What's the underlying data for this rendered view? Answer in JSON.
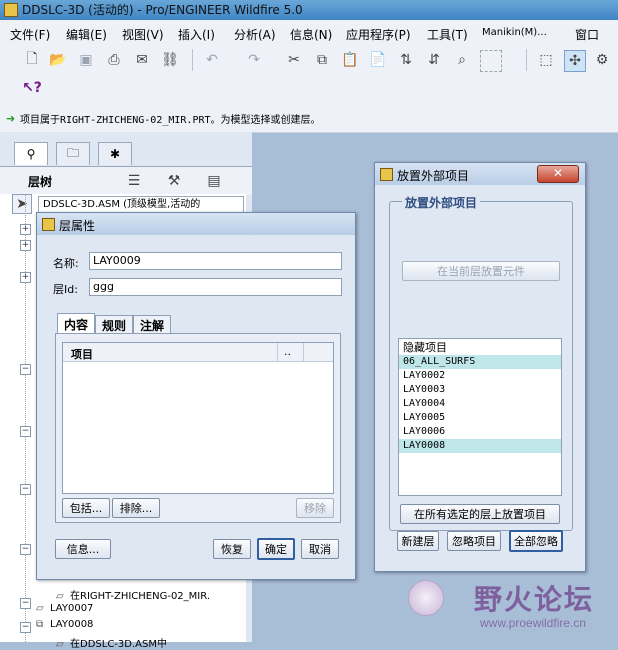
{
  "window": {
    "title": "DDSLC-3D (活动的) - Pro/ENGINEER Wildfire 5.0"
  },
  "menu": [
    "文件(F)",
    "编辑(E)",
    "视图(V)",
    "插入(I)",
    "分析(A)",
    "信息(N)",
    "应用程序(P)",
    "工具(T)",
    "Manikin(M)...",
    "窗口(W)"
  ],
  "status_message": "项目属于RIGHT-ZHICHENG-02_MIR.PRT。为模型选择或创建层。",
  "left_panel": {
    "header_label": "层树",
    "model_select": "DDSLC-3D.ASM (顶级模型,活动的",
    "tree_items": [
      "在RIGHT-ZHICHENG-02_MIR.",
      "LAY0007",
      "LAY0008",
      "在DDSLC-3D.ASM中"
    ]
  },
  "layer_props": {
    "title": "层属性",
    "name_label": "名称:",
    "name_value": "LAY0009",
    "id_label": "层Id:",
    "id_value": "ggg",
    "tabs": [
      "内容",
      "规则",
      "注解"
    ],
    "columns": [
      "项目",
      ".."
    ],
    "buttons": {
      "include": "包括...",
      "exclude": "排除...",
      "remove": "移除",
      "info": "信息...",
      "restore": "恢复",
      "ok": "确定",
      "cancel": "取消"
    }
  },
  "place_items": {
    "title": "放置外部项目",
    "group_label": "放置外部项目",
    "place_on_current": "在当前层放置元件",
    "list": [
      {
        "label": "隐藏项目",
        "selected": false
      },
      {
        "label": "06_ALL_SURFS",
        "selected": true
      },
      {
        "label": "LAY0002",
        "selected": false
      },
      {
        "label": "LAY0003",
        "selected": false
      },
      {
        "label": "LAY0004",
        "selected": false
      },
      {
        "label": "LAY0005",
        "selected": false
      },
      {
        "label": "LAY0006",
        "selected": false
      },
      {
        "label": "LAY0008",
        "selected": true
      }
    ],
    "place_all": "在所有选定的层上放置项目",
    "buttons": {
      "new_layer": "新建层",
      "ignore": "忽略项目",
      "ignore_all": "全部忽略"
    }
  },
  "watermark": {
    "text_cn": "野火论坛",
    "url": "www.proewildfire.cn"
  },
  "colors": {
    "accent": "#2f5fa0",
    "selection": "#bfe7ea",
    "close": "#c4452f"
  }
}
